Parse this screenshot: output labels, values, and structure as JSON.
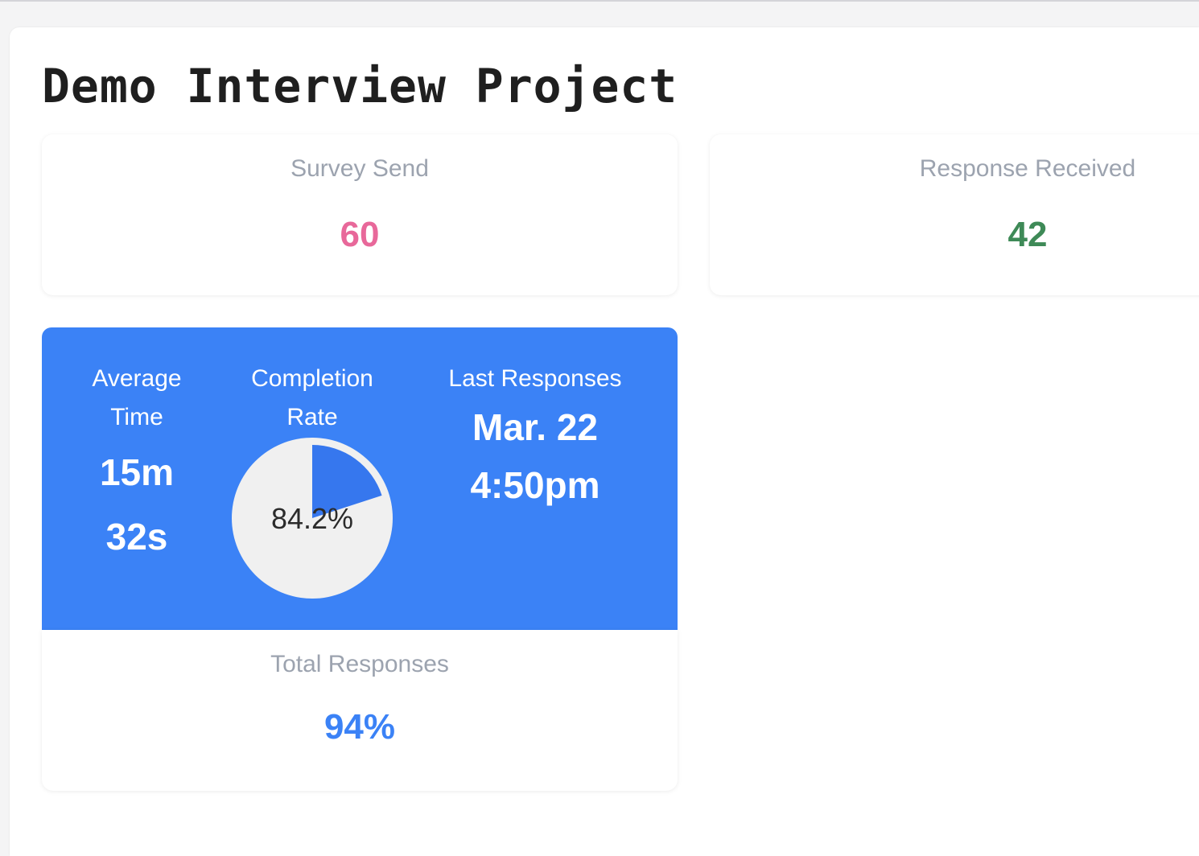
{
  "project": {
    "title": "Demo Interview Project"
  },
  "stats": {
    "survey_send": {
      "label": "Survey Send",
      "value": "60",
      "color": "#e8689a"
    },
    "response_received": {
      "label": "Response Received",
      "value": "42",
      "color": "#3e8a57"
    },
    "total_responses": {
      "label": "Total Responses",
      "value": "94%",
      "color": "#3b82f6"
    }
  },
  "metrics": {
    "background": "#3b82f6",
    "average_time": {
      "label_line1": "Average",
      "label_line2": "Time",
      "value_line1": "15m",
      "value_line2": "32s"
    },
    "completion_rate": {
      "label_line1": "Completion",
      "label_line2": "Rate",
      "value_text": "84.2%",
      "fraction": 0.2,
      "fill_color": "#3677ee",
      "background_color": "#f0f0f0"
    },
    "last_responses": {
      "label": "Last Responses",
      "value_line1": "Mar. 22",
      "value_line2": "4:50pm"
    }
  }
}
